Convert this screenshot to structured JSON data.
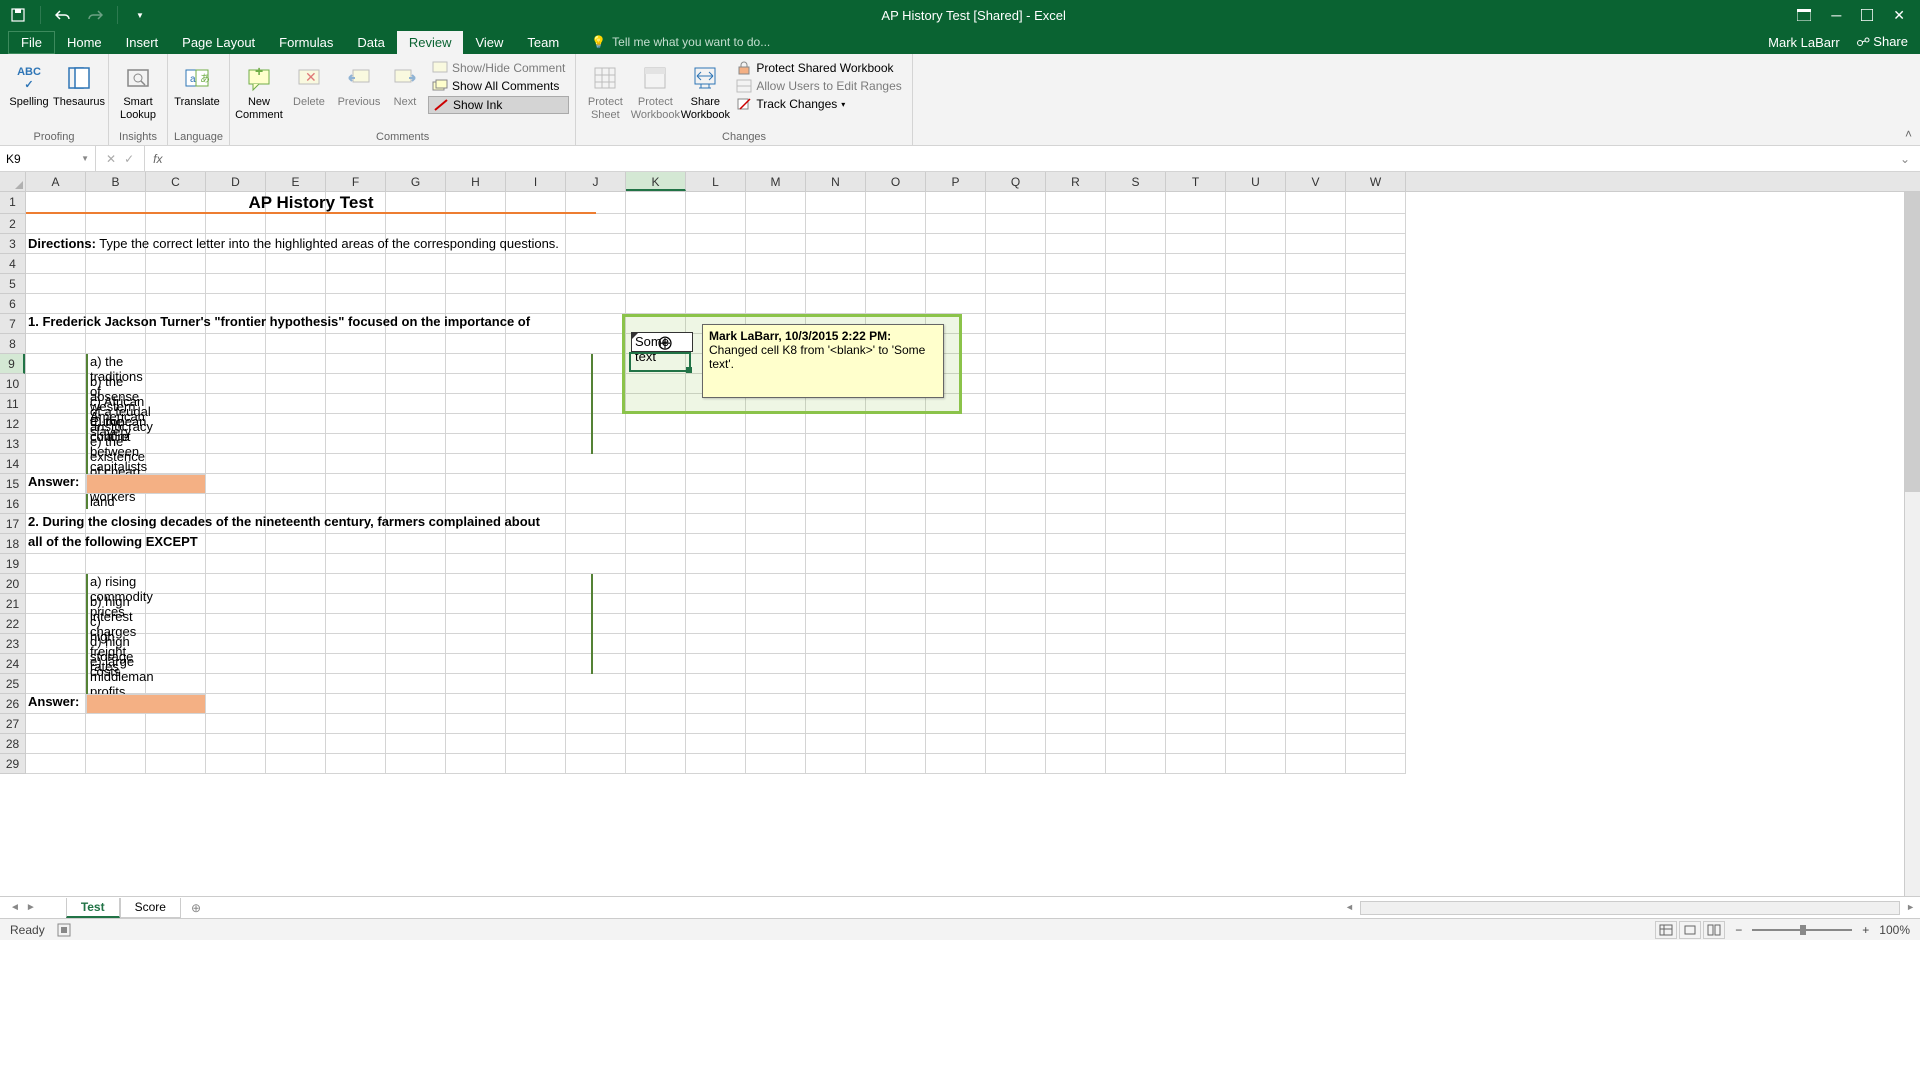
{
  "title_bar": {
    "app_title": "AP History Test  [Shared] - Excel"
  },
  "ribbon_tabs": {
    "file": "File",
    "tabs": [
      "Home",
      "Insert",
      "Page Layout",
      "Formulas",
      "Data",
      "Review",
      "View",
      "Team"
    ],
    "active": "Review",
    "tell_me": "Tell me what you want to do...",
    "user": "Mark LaBarr",
    "share": "Share"
  },
  "ribbon": {
    "proofing": {
      "label": "Proofing",
      "spelling": "Spelling",
      "thesaurus": "Thesaurus"
    },
    "insights": {
      "label": "Insights",
      "smart_lookup": "Smart\nLookup"
    },
    "language": {
      "label": "Language",
      "translate": "Translate"
    },
    "comments": {
      "label": "Comments",
      "new_comment": "New\nComment",
      "delete": "Delete",
      "previous": "Previous",
      "next": "Next",
      "show_hide": "Show/Hide Comment",
      "show_all": "Show All Comments",
      "show_ink": "Show Ink"
    },
    "changes": {
      "label": "Changes",
      "protect_sheet": "Protect\nSheet",
      "protect_workbook": "Protect\nWorkbook",
      "share_workbook": "Share\nWorkbook",
      "protect_shared": "Protect Shared Workbook",
      "allow_users": "Allow Users to Edit Ranges",
      "track_changes": "Track Changes"
    }
  },
  "formula_bar": {
    "name_box": "K9",
    "formula": ""
  },
  "columns": [
    "A",
    "B",
    "C",
    "D",
    "E",
    "F",
    "G",
    "H",
    "I",
    "J",
    "K",
    "L",
    "M",
    "N",
    "O",
    "P",
    "Q",
    "R",
    "S",
    "T",
    "U",
    "V",
    "W"
  ],
  "active_column": "K",
  "active_row": 9,
  "worksheet": {
    "title": "AP History Test",
    "directions_label": "Directions:",
    "directions_text": "Type the correct letter into the highlighted areas of the corresponding questions.",
    "q1": {
      "text": "1. Frederick Jackson Turner's \"frontier hypothesis\" focused on the importance of",
      "options": [
        "a) the traditions of western European culture",
        "b) the absense of a feudal aristocracy",
        "c) African American slavery",
        "d) the conflict between capitalists and workers",
        "e) the existence of cheap unsettled land"
      ]
    },
    "answer_label": "Answer:",
    "q2": {
      "text_line1": "2. During the closing decades of the nineteenth century, farmers complained about",
      "text_line2": "all of the following EXCEPT",
      "options": [
        "a) rising commodity prices",
        "b) high interest charges",
        "c) high freight rates",
        "d) high storage costs",
        "e) large middleman profits"
      ]
    }
  },
  "track_change": {
    "cell_value": "Some text",
    "author_line": "Mark LaBarr, 10/3/2015 2:22 PM:",
    "description": "Changed cell K8 from '<blank>' to 'Some text'."
  },
  "sheet_tabs": {
    "tabs": [
      "Test",
      "Score"
    ],
    "active": "Test"
  },
  "status_bar": {
    "ready": "Ready",
    "zoom": "100%"
  }
}
